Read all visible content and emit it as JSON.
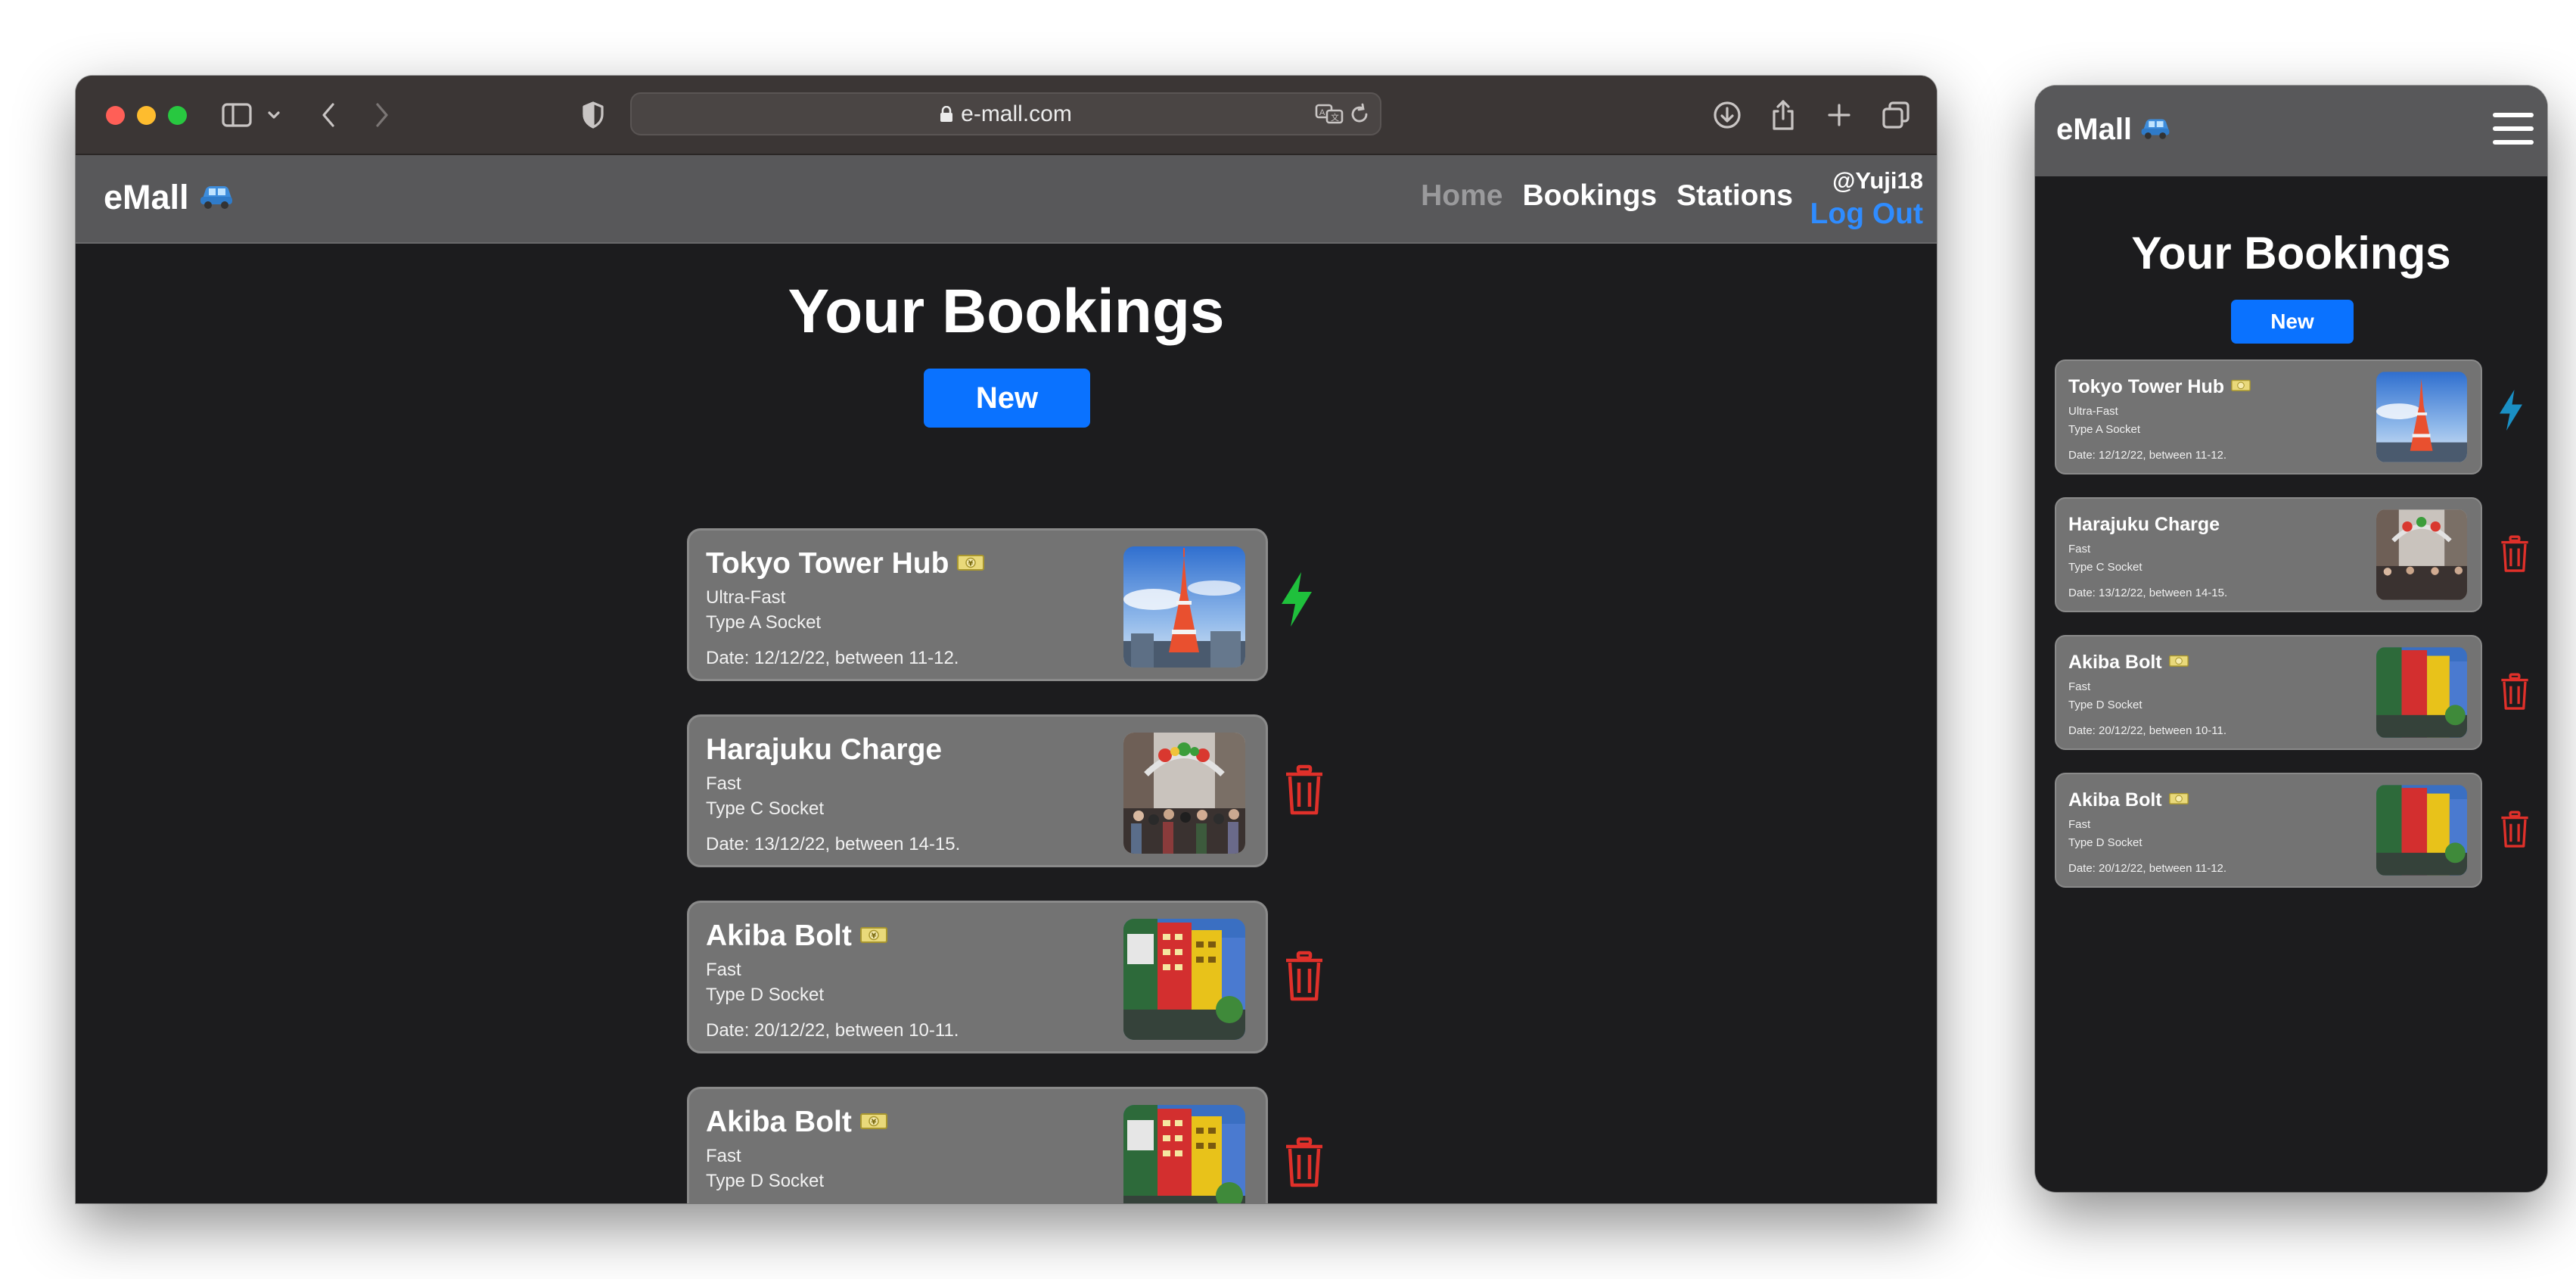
{
  "browser": {
    "url": "e-mall.com"
  },
  "app": {
    "brand": "eMall",
    "nav": {
      "home": "Home",
      "bookings": "Bookings",
      "stations": "Stations"
    },
    "user": {
      "name": "@Yuji18",
      "logout": "Log Out"
    }
  },
  "page": {
    "title": "Your Bookings",
    "new_button": "New"
  },
  "bookings": [
    {
      "name": "Tokyo Tower Hub",
      "paid_icon": "yen-banknote-icon",
      "speed": "Ultra-Fast",
      "socket": "Type A Socket",
      "date": "Date: 12/12/22, between 11-12.",
      "image": "tokyo-tower-photo",
      "action": "charging-bolt-icon"
    },
    {
      "name": "Harajuku Charge",
      "paid_icon": "",
      "speed": "Fast",
      "socket": "Type C Socket",
      "date": "Date: 13/12/22, between 14-15.",
      "image": "harajuku-street-photo",
      "action": "trash-icon"
    },
    {
      "name": "Akiba Bolt",
      "paid_icon": "yen-banknote-icon",
      "speed": "Fast",
      "socket": "Type D Socket",
      "date": "Date: 20/12/22, between 10-11.",
      "image": "akihabara-buildings-photo",
      "action": "trash-icon"
    },
    {
      "name": "Akiba Bolt",
      "paid_icon": "yen-banknote-icon",
      "speed": "Fast",
      "socket": "Type D Socket",
      "date": "Date: 20/12/22, between 11-12.",
      "image": "akihabara-buildings-photo",
      "action": "trash-icon"
    }
  ],
  "colors": {
    "accent": "#0a72ff",
    "link_blue": "#2f8cff",
    "bolt_desktop": "#1fc03c",
    "bolt_mobile": "#1a8fc4",
    "trash": "#e0302a",
    "card": "#737373",
    "navbar": "#58585a",
    "background": "#1c1c1e"
  }
}
